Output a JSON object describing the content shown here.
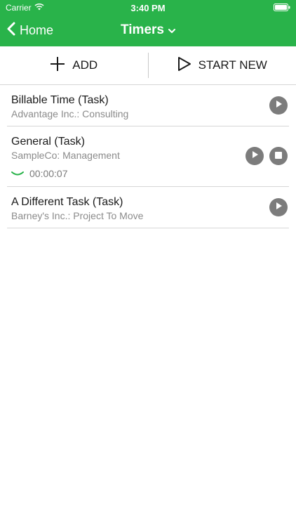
{
  "status_bar": {
    "carrier": "Carrier",
    "time": "3:40 PM"
  },
  "nav": {
    "back_label": "Home",
    "title": "Timers"
  },
  "actions": {
    "add_label": "ADD",
    "start_new_label": "START NEW"
  },
  "timers": [
    {
      "title": "Billable Time (Task)",
      "subtitle": "Advantage Inc.: Consulting",
      "running": false
    },
    {
      "title": "General (Task)",
      "subtitle": "SampleCo: Management",
      "running": true,
      "elapsed": "00:00:07"
    },
    {
      "title": "A Different Task (Task)",
      "subtitle": "Barney's Inc.: Project To Move",
      "running": false
    }
  ],
  "colors": {
    "header_green": "#29b34a",
    "button_gray": "#7c7c7c",
    "accent_green": "#29b34a"
  },
  "icons": {
    "wifi": "wifi-icon",
    "battery": "battery-icon",
    "back": "chevron-left-icon",
    "title_dropdown": "chevron-down-icon",
    "add": "plus-icon",
    "start_new": "play-outline-icon",
    "play": "play-icon",
    "stop": "stop-icon",
    "expand": "chevron-down-icon"
  }
}
